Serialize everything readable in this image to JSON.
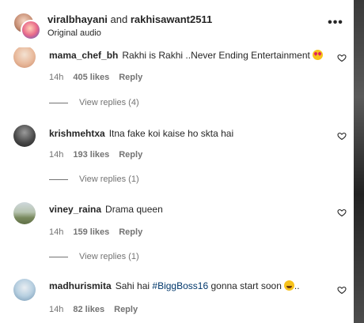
{
  "header": {
    "user1": "viralbhayani",
    "conjunction": "and",
    "user2": "rakhisawant2511",
    "subtitle": "Original audio",
    "more_icon": "more-horizontal-icon"
  },
  "comments": [
    {
      "username": "mama_chef_bh",
      "text": "Rakhi is Rakhi ..Never Ending Entertainment",
      "emoji": "heart-eyes-emoji",
      "time": "14h",
      "likes": "405 likes",
      "reply": "Reply",
      "view_replies": "View replies (4)"
    },
    {
      "username": "krishmehtxa",
      "text": "Itna fake koi kaise ho skta hai",
      "time": "14h",
      "likes": "193 likes",
      "reply": "Reply",
      "view_replies": "View replies (1)"
    },
    {
      "username": "viney_raina",
      "text": "Drama queen",
      "time": "14h",
      "likes": "159 likes",
      "reply": "Reply",
      "view_replies": "View replies (1)"
    },
    {
      "username": "madhurismita",
      "text_before": "Sahi hai",
      "hashtag": "#BiggBoss16",
      "text_after": "gonna start soon",
      "emoji": "laughing-emoji",
      "ellipsis": "..",
      "time": "14h",
      "likes": "82 likes",
      "reply": "Reply"
    }
  ],
  "colors": {
    "text": "#262626",
    "secondary": "#737373",
    "hashtag": "#00376b"
  }
}
